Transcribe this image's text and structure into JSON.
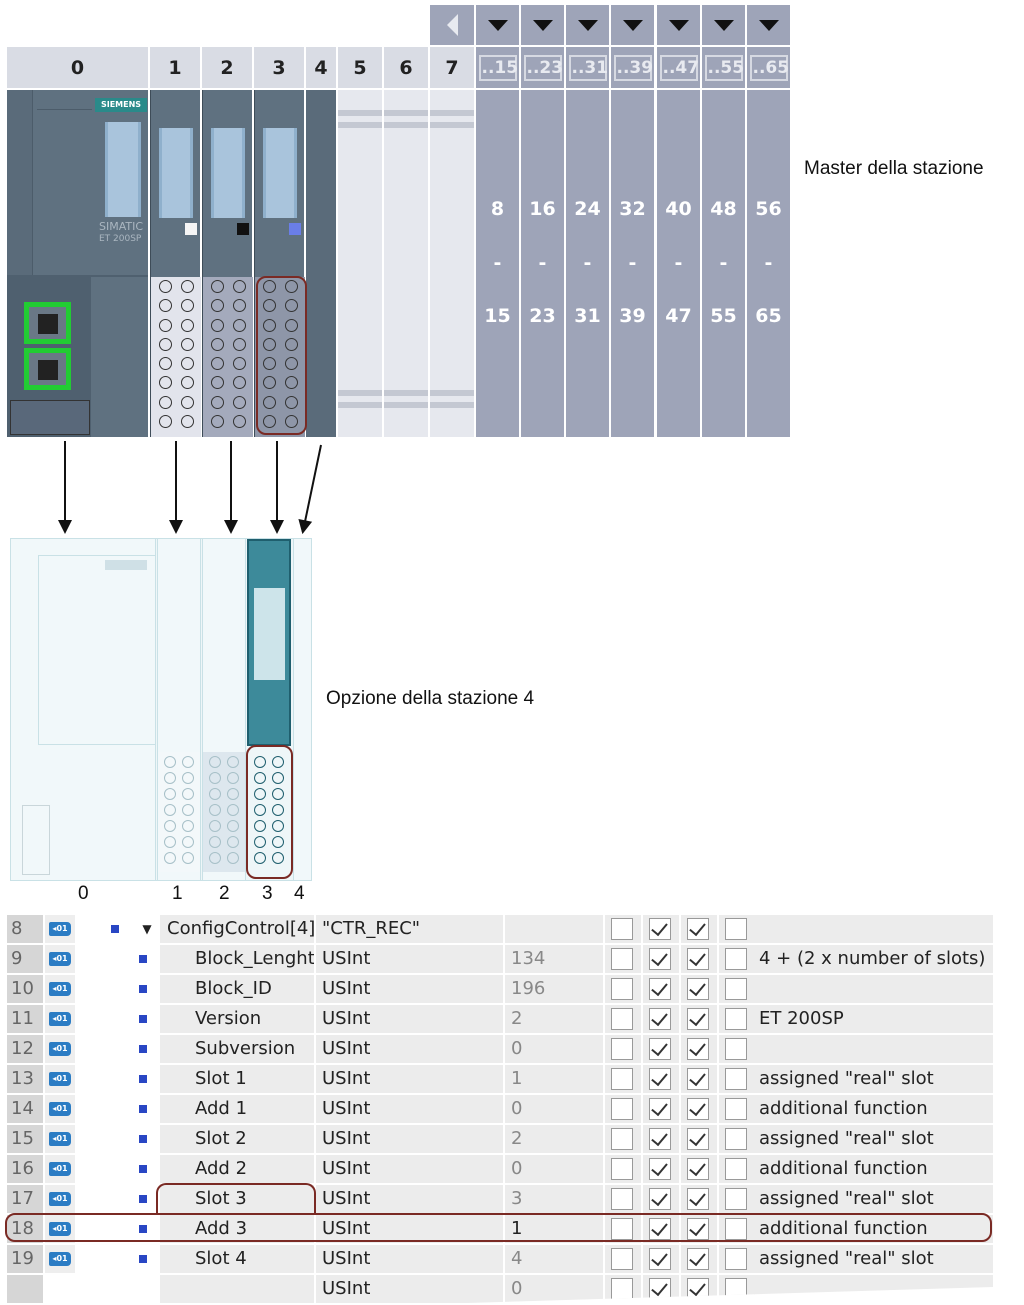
{
  "rack": {
    "slots": [
      "0",
      "1",
      "2",
      "3",
      "4",
      "5",
      "6",
      "7"
    ],
    "groups": [
      "..15",
      "..23",
      "..31",
      "..39",
      "..47",
      "..55",
      "..65"
    ],
    "group_ranges": [
      {
        "from": "8",
        "sep": "-",
        "to": "15"
      },
      {
        "from": "16",
        "sep": "-",
        "to": "23"
      },
      {
        "from": "24",
        "sep": "-",
        "to": "31"
      },
      {
        "from": "32",
        "sep": "-",
        "to": "39"
      },
      {
        "from": "40",
        "sep": "-",
        "to": "47"
      },
      {
        "from": "48",
        "sep": "-",
        "to": "55"
      },
      {
        "from": "56",
        "sep": "-",
        "to": "65"
      }
    ],
    "brand": "SIEMENS",
    "product": "SIMATIC",
    "product_line": "ET 200SP",
    "colors": {
      "module": "#5f7180",
      "brand": "#2a8a8a",
      "highlight": "#7a2a24",
      "port": "#22cc33"
    }
  },
  "annotations": {
    "master": "Master della stazione",
    "option": "Opzione della stazione 4"
  },
  "lower_slots": [
    "0",
    "1",
    "2",
    "3",
    "4"
  ],
  "table": {
    "rows": [
      {
        "num": "8",
        "name": "ConfigControl[4]",
        "type": "\"CTR_REC\"",
        "value": "",
        "c": [
          false,
          true,
          true,
          false
        ],
        "comment": "",
        "expand": true
      },
      {
        "num": "9",
        "name": "Block_Lenght",
        "type": "USInt",
        "value": "134",
        "c": [
          false,
          true,
          true,
          false
        ],
        "comment": "4 + (2 x number of slots)"
      },
      {
        "num": "10",
        "name": "Block_ID",
        "type": "USInt",
        "value": "196",
        "c": [
          false,
          true,
          true,
          false
        ],
        "comment": ""
      },
      {
        "num": "11",
        "name": "Version",
        "type": "USInt",
        "value": "2",
        "c": [
          false,
          true,
          true,
          false
        ],
        "comment": "ET 200SP"
      },
      {
        "num": "12",
        "name": "Subversion",
        "type": "USInt",
        "value": "0",
        "c": [
          false,
          true,
          true,
          false
        ],
        "comment": ""
      },
      {
        "num": "13",
        "name": "Slot 1",
        "type": "USInt",
        "value": "1",
        "c": [
          false,
          true,
          true,
          false
        ],
        "comment": "assigned \"real\" slot"
      },
      {
        "num": "14",
        "name": "Add 1",
        "type": "USInt",
        "value": "0",
        "c": [
          false,
          true,
          true,
          false
        ],
        "comment": "additional function"
      },
      {
        "num": "15",
        "name": "Slot 2",
        "type": "USInt",
        "value": "2",
        "c": [
          false,
          true,
          true,
          false
        ],
        "comment": "assigned \"real\" slot"
      },
      {
        "num": "16",
        "name": "Add 2",
        "type": "USInt",
        "value": "0",
        "c": [
          false,
          true,
          true,
          false
        ],
        "comment": "additional function"
      },
      {
        "num": "17",
        "name": "Slot 3",
        "type": "USInt",
        "value": "3",
        "c": [
          false,
          true,
          true,
          false
        ],
        "comment": "assigned \"real\" slot"
      },
      {
        "num": "18",
        "name": "Add 3",
        "type": "USInt",
        "value": "1",
        "c": [
          false,
          true,
          true,
          false
        ],
        "comment": "additional function"
      },
      {
        "num": "19",
        "name": "Slot 4",
        "type": "USInt",
        "value": "4",
        "c": [
          false,
          true,
          true,
          false
        ],
        "comment": "assigned \"real\" slot"
      },
      {
        "num": "",
        "name": "",
        "type": "USInt",
        "value": "0",
        "c": [
          false,
          true,
          true,
          false
        ],
        "comment": ""
      }
    ]
  }
}
